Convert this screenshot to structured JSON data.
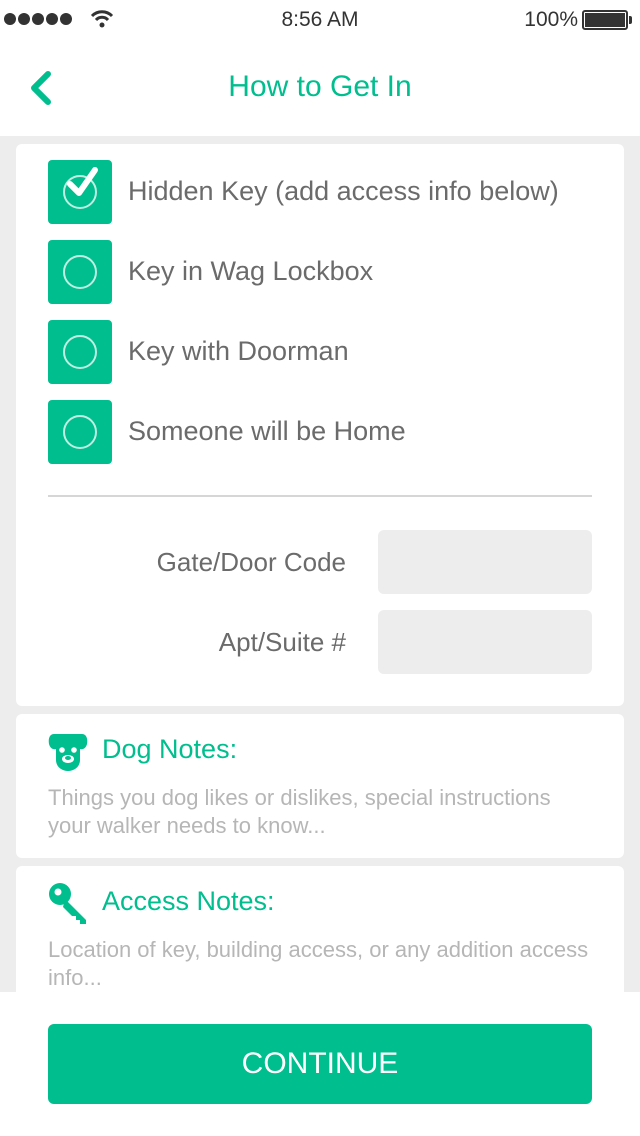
{
  "status_bar": {
    "time": "8:56 AM",
    "battery": "100%",
    "icons": [
      "signal-dots-icon",
      "wifi-icon",
      "battery-icon"
    ]
  },
  "nav": {
    "back_icon": "chevron-left-icon",
    "title": "How to Get In"
  },
  "access_options": [
    {
      "label": "Hidden Key (add access info below)",
      "checked": true
    },
    {
      "label": "Key in Wag Lockbox",
      "checked": false
    },
    {
      "label": "Key with Doorman",
      "checked": false
    },
    {
      "label": "Someone will be Home",
      "checked": false
    }
  ],
  "fields": {
    "gate_code": {
      "label": "Gate/Door Code",
      "value": ""
    },
    "apt_suite": {
      "label": "Apt/Suite #",
      "value": ""
    }
  },
  "dog_notes": {
    "icon": "dog-face-icon",
    "title": "Dog Notes:",
    "placeholder": "Things you dog likes or dislikes, special instructions your walker needs to know..."
  },
  "access_notes": {
    "icon": "key-icon",
    "title": "Access Notes:",
    "placeholder": "Location of key, building access, or any addition access info..."
  },
  "continue_label": "CONTINUE",
  "colors": {
    "accent": "#00be8e",
    "background": "#ededed",
    "text": "#6b6b6b",
    "placeholder": "#b6b6b6"
  }
}
